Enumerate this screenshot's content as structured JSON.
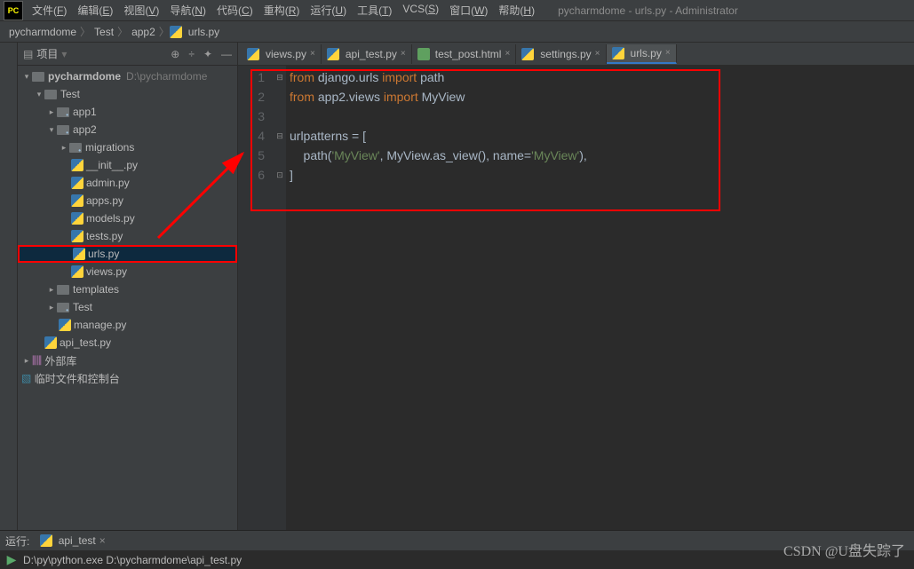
{
  "window": {
    "logo": "PC",
    "title": "pycharmdome - urls.py - Administrator"
  },
  "menu": [
    {
      "t": "文件",
      "u": "F"
    },
    {
      "t": "编辑",
      "u": "E"
    },
    {
      "t": "视图",
      "u": "V"
    },
    {
      "t": "导航",
      "u": "N"
    },
    {
      "t": "代码",
      "u": "C"
    },
    {
      "t": "重构",
      "u": "R"
    },
    {
      "t": "运行",
      "u": "U"
    },
    {
      "t": "工具",
      "u": "T"
    },
    {
      "t": "VCS",
      "u": "S"
    },
    {
      "t": "窗口",
      "u": "W"
    },
    {
      "t": "帮助",
      "u": "H"
    }
  ],
  "breadcrumbs": {
    "p0": "pycharmdome",
    "p1": "Test",
    "p2": "app2",
    "p3": "urls.py"
  },
  "sidebar": {
    "title": "项目",
    "tools": {
      "t1": "⊕",
      "t2": "÷",
      "t3": "✦",
      "t4": "—"
    },
    "tree": {
      "root": {
        "name": "pycharmdome",
        "hint": "D:\\pycharmdome"
      },
      "test": "Test",
      "app1": "app1",
      "app2": "app2",
      "migrations": "migrations",
      "init": "__init__.py",
      "admin": "admin.py",
      "apps": "apps.py",
      "models": "models.py",
      "tests": "tests.py",
      "urls": "urls.py",
      "views": "views.py",
      "templates": "templates",
      "test2": "Test",
      "manage": "manage.py",
      "api_test": "api_test.py",
      "ext": "外部库",
      "scr": "临时文件和控制台"
    }
  },
  "tabs": {
    "t0": "views.py",
    "t1": "api_test.py",
    "t2": "test_post.html",
    "t3": "settings.py",
    "t4": "urls.py"
  },
  "code": {
    "l1": {
      "a": "from ",
      "b": "django.urls ",
      "c": "import ",
      "d": "path"
    },
    "l2": {
      "a": "from ",
      "b": "app2",
      "c": ".views ",
      "d": "import ",
      "e": "MyView"
    },
    "l3": "",
    "l4": {
      "a": "urlpatterns = ["
    },
    "l5": {
      "a": "    path(",
      "b": "'MyView'",
      "c": ", MyView.as_view(), name=",
      "d": "'MyView'",
      "e": "),"
    },
    "l6": {
      "a": "]"
    },
    "nums": [
      "1",
      "2",
      "3",
      "4",
      "5",
      "6"
    ]
  },
  "terminal": {
    "runlabel": "运行:",
    "tab": "api_test",
    "cmd": "D:\\py\\python.exe D:\\pycharmdome\\api_test.py"
  },
  "watermark": "CSDN @U盘失踪了"
}
